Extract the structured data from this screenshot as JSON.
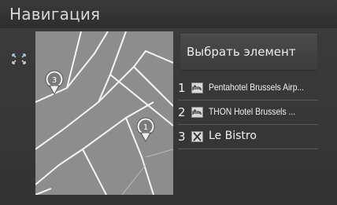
{
  "header": {
    "title": "Навигация"
  },
  "controls": {
    "select_item_label": "Выбрать элемент"
  },
  "map": {
    "markers": [
      {
        "number": "3"
      },
      {
        "number": "1"
      }
    ]
  },
  "results": [
    {
      "number": "1",
      "name": "Pentahotel Brussels Airp...",
      "icon": "hotel-icon"
    },
    {
      "number": "2",
      "name": "THON Hotel Brussels ...",
      "icon": "hotel-icon"
    },
    {
      "number": "3",
      "name": "Le Bistro",
      "icon": "restaurant-icon"
    }
  ]
}
